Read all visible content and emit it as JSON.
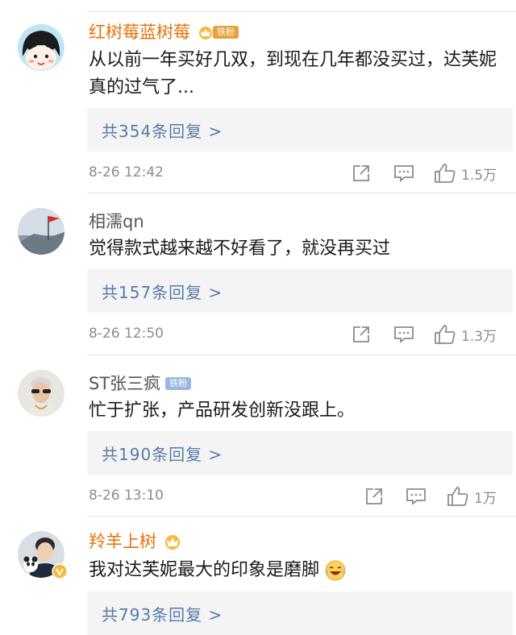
{
  "comments": [
    {
      "username": "红树莓蓝树莓",
      "badge": "铁粉",
      "text": "从以前一年买好几双，到现在几年都没买过，达芙妮真的过气了...",
      "replies": "共354条回复 >",
      "time": "8-26 12:42",
      "likes": "1.5万"
    },
    {
      "username": "相濡qn",
      "badge": "",
      "text": "觉得款式越来越不好看了，就没再买过",
      "replies": "共157条回复 >",
      "time": "8-26 12:50",
      "likes": "1.3万"
    },
    {
      "username": "ST张三疯",
      "badge": "铁粉",
      "text": "忙于扩张，产品研发创新没跟上。",
      "replies": "共190条回复 >",
      "time": "8-26 13:10",
      "likes": "1万"
    },
    {
      "username": "羚羊上树",
      "badge": "",
      "text": "我对达芙妮最大的印象是磨脚",
      "emoji": "crying-laughing-emoji",
      "replies": "共793条回复 >"
    }
  ],
  "colors": {
    "vip_name": "#e8710a",
    "reply_link": "#567ba8",
    "meta": "#8c8c8c",
    "badge_gold": "#e8a23c",
    "badge_blue": "#9ab8e2"
  }
}
